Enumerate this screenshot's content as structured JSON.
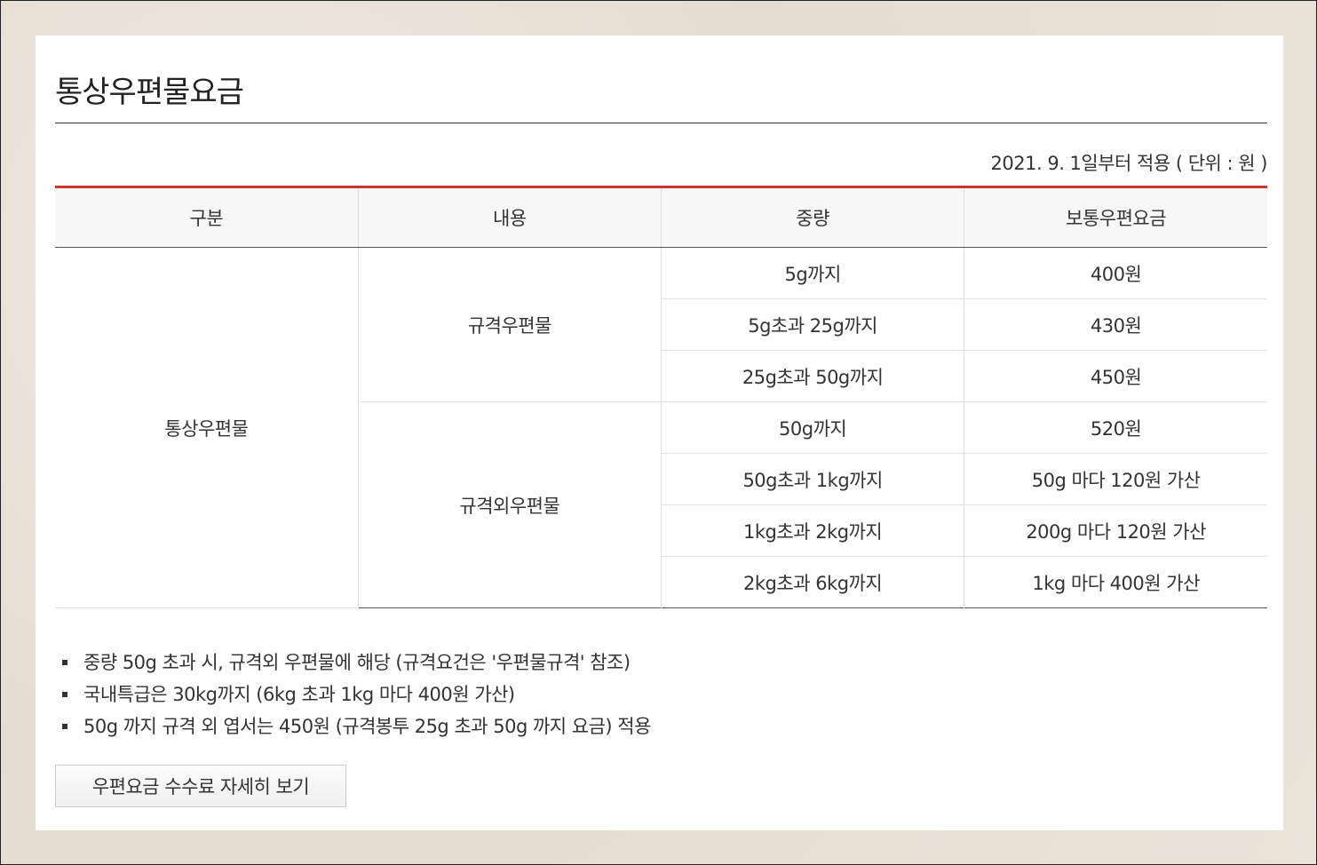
{
  "page": {
    "title": "통상우편물요금"
  },
  "meta": {
    "effective_note": "2021. 9. 1일부터 적용 ( 단위 : 원 )"
  },
  "table": {
    "headers": [
      "구분",
      "내용",
      "중량",
      "보통우편요금"
    ],
    "category": "통상우편물",
    "groups": [
      {
        "content": "규격우편물",
        "rows": [
          {
            "weight": "5g까지",
            "fee": "400원"
          },
          {
            "weight": "5g초과 25g까지",
            "fee": "430원"
          },
          {
            "weight": "25g초과 50g까지",
            "fee": "450원"
          }
        ]
      },
      {
        "content": "규격외우편물",
        "rows": [
          {
            "weight": "50g까지",
            "fee": "520원"
          },
          {
            "weight": "50g초과 1kg까지",
            "fee": "50g 마다 120원 가산"
          },
          {
            "weight": "1kg초과 2kg까지",
            "fee": "200g 마다 120원 가산"
          },
          {
            "weight": "2kg초과 6kg까지",
            "fee": "1kg 마다 400원 가산"
          }
        ]
      }
    ]
  },
  "notes": [
    "중량 50g 초과 시, 규격외 우편물에 해당 (규격요건은 '우편물규격' 참조)",
    "국내특급은 30kg까지 (6kg 초과 1kg 마다 400원 가산)",
    "50g 까지 규격 외 엽서는 450원 (규격봉투 25g 초과 50g 까지 요금) 적용"
  ],
  "detail_button": {
    "label": "우편요금 수수료 자세히 보기"
  },
  "colors": {
    "accent": "#c0392b",
    "background": "#e9e1d7",
    "panel": "#ffffff"
  }
}
